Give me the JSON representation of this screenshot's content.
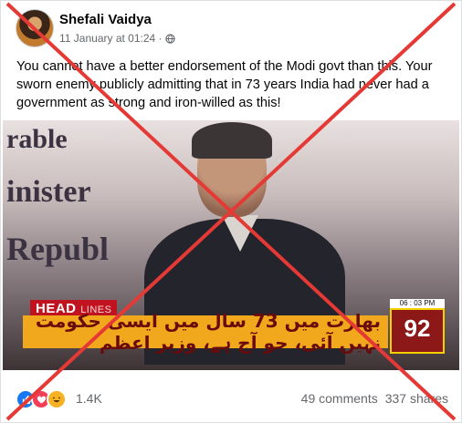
{
  "post": {
    "author": "Shefali Vaidya",
    "timestamp": "11 January at 01:24 ·",
    "privacy_icon": "globe-icon",
    "text": "You cannot have a better endorsement of the Modi govt than this. Your sworn enemy publicly admitting that in 73 years India had never had a government as strong and iron-willed as this!"
  },
  "media": {
    "bg_line1": "rable",
    "bg_line2": "inister",
    "bg_line3": "Republ",
    "headline_label": "HEAD",
    "headline_suffix": "LINES",
    "ticker_text": "بھارت میں 73 سال میں ایسی حکومت نہیں آئی، جو آج ہے، وزیر اعظم",
    "channel_logo": "92",
    "channel_time": "06 : 03 PM"
  },
  "footer": {
    "reactions": [
      "like-icon",
      "love-icon",
      "haha-icon"
    ],
    "reaction_count": "1.4K",
    "comments": "49 comments",
    "shares": "337 shares"
  },
  "colors": {
    "cross": "#e53935",
    "ticker": "#f2a81c",
    "headline_red": "#c1121f"
  }
}
